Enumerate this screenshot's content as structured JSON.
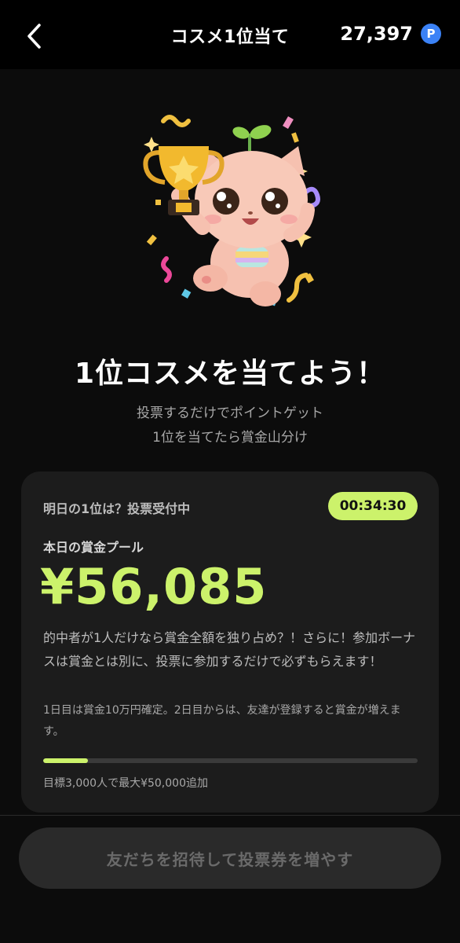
{
  "header": {
    "title": "コスメ1位当て",
    "points": "27,397",
    "points_badge": "P"
  },
  "hero": {
    "headline": "1位コスメを当てよう！",
    "sub_line1": "投票するだけでポイントゲット",
    "sub_line2": "1位を当てたら賞金山分け"
  },
  "card": {
    "status": "明日の1位は？投票受付中",
    "timer": "00:34:30",
    "pool_label": "本日の賞金プール",
    "pool_amount": "¥56,085",
    "description": "的中者が1人だけなら賞金全額を独り占め？！さらに！参加ボーナスは賞金とは別に、投票に参加するだけで必ずもらえます！",
    "note": "1日目は賞金10万円確定。2日目からは、友達が登録すると賞金が増えます。",
    "progress_fraction": 0.12,
    "goal": "目標3,000人で最大¥50,000追加"
  },
  "cta": {
    "label": "友だちを招待して投票券を増やす"
  },
  "colors": {
    "accent": "#ccf26b",
    "points_badge": "#3b82f6",
    "background": "#0c0c0c",
    "card": "#1c1c1c"
  },
  "icons": [
    "back-chevron-icon",
    "points-badge-icon",
    "mascot-trophy-illustration"
  ]
}
